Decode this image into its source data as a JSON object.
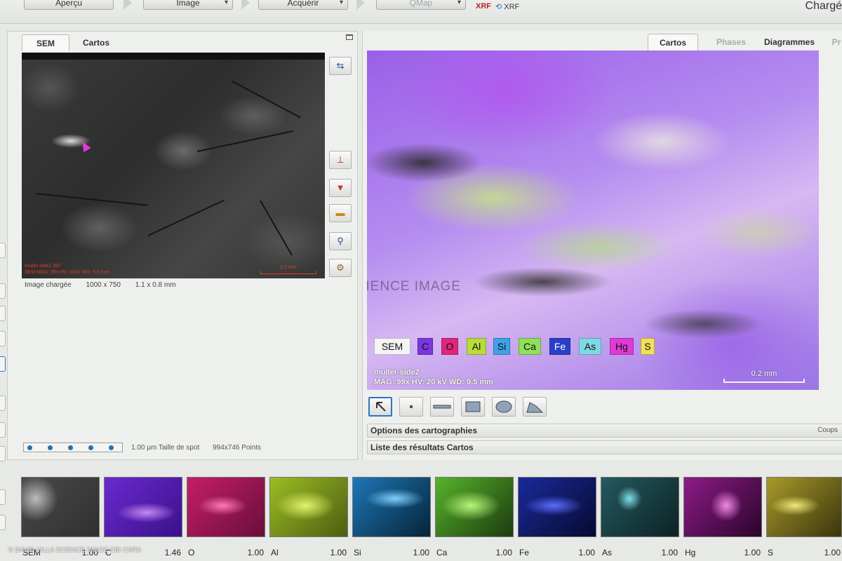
{
  "toolbar": {
    "steps": [
      {
        "label": "Aperçu",
        "has_menu": false,
        "enabled": true
      },
      {
        "label": "Image",
        "has_menu": true,
        "enabled": true
      },
      {
        "label": "Acquérir",
        "has_menu": true,
        "enabled": true
      },
      {
        "label": "QMap",
        "has_menu": true,
        "enabled": false
      }
    ],
    "xrf_label": "XRF",
    "xrf_sync_label": "XRF",
    "status_title": "Chargé"
  },
  "left_panel": {
    "tabs": [
      {
        "label": "SEM",
        "active": true
      },
      {
        "label": "Cartos",
        "active": false
      }
    ],
    "sem_overlay": {
      "line1": "muller-side2 387",
      "line2": "SEM  MAG: 99x  HV: 20kV  WD: 9.5 mm",
      "scale_label": "0.2 mm"
    },
    "image_status": {
      "label": "Image chargée",
      "resolution": "1000 x 750",
      "size": "1.1 x 0.8 mm"
    },
    "spot": {
      "size_text": "1.00 µm Taille de spot",
      "points_text": "994x746 Points",
      "dots": 5
    }
  },
  "right_panel": {
    "tabs": [
      {
        "label": "Cartos",
        "active": true
      },
      {
        "label": "Phases",
        "active": false,
        "dim": true
      },
      {
        "label": "Diagrammes",
        "active": false
      },
      {
        "label": "Pr",
        "active": false,
        "dim": true
      }
    ],
    "legend": [
      {
        "label": "SEM",
        "color": "#f4f4f4"
      },
      {
        "label": "C",
        "color": "#7a36e0"
      },
      {
        "label": "O",
        "color": "#e0267a"
      },
      {
        "label": "Al",
        "color": "#b8dc3c"
      },
      {
        "label": "Si",
        "color": "#3fa2e6"
      },
      {
        "label": "Ca",
        "color": "#8ee05a"
      },
      {
        "label": "Fe",
        "color": "#2a3fc8"
      },
      {
        "label": "As",
        "color": "#7fd8e6"
      },
      {
        "label": "Hg",
        "color": "#e03ad6"
      },
      {
        "label": "S",
        "color": "#f1e05a"
      }
    ],
    "map_overlay": {
      "line1": "muller-side2",
      "line2": "MAG: 99x   HV: 20 kV   WD: 9.5 mm",
      "scale_label": "0.2 mm"
    },
    "watermark": "SCIENCE IMAGE",
    "sections": [
      {
        "label": "Options des cartographies",
        "right_label": "Coups"
      },
      {
        "label": "Liste des résultats Cartos",
        "right_label": ""
      }
    ]
  },
  "thumbnails": [
    {
      "element": "SEM",
      "value": "1.00",
      "color": "#5a5b5a"
    },
    {
      "element": "C",
      "value": "1.46",
      "color": "#7a36e0"
    },
    {
      "element": "O",
      "value": "1.00",
      "color": "#d62a6e"
    },
    {
      "element": "Al",
      "value": "1.00",
      "color": "#b0cf32"
    },
    {
      "element": "Si",
      "value": "1.00",
      "color": "#2f8ed0"
    },
    {
      "element": "Ca",
      "value": "1.00",
      "color": "#6ec83e"
    },
    {
      "element": "Fe",
      "value": "1.00",
      "color": "#2332a8"
    },
    {
      "element": "As",
      "value": "1.00",
      "color": "#3b8e98"
    },
    {
      "element": "Hg",
      "value": "1.00",
      "color": "#b62aae"
    },
    {
      "element": "S",
      "value": "1.00",
      "color": "#cfc24a"
    }
  ],
  "credit": "© DAVID VILLA SCIENCE IMAGE CBI CNRS"
}
